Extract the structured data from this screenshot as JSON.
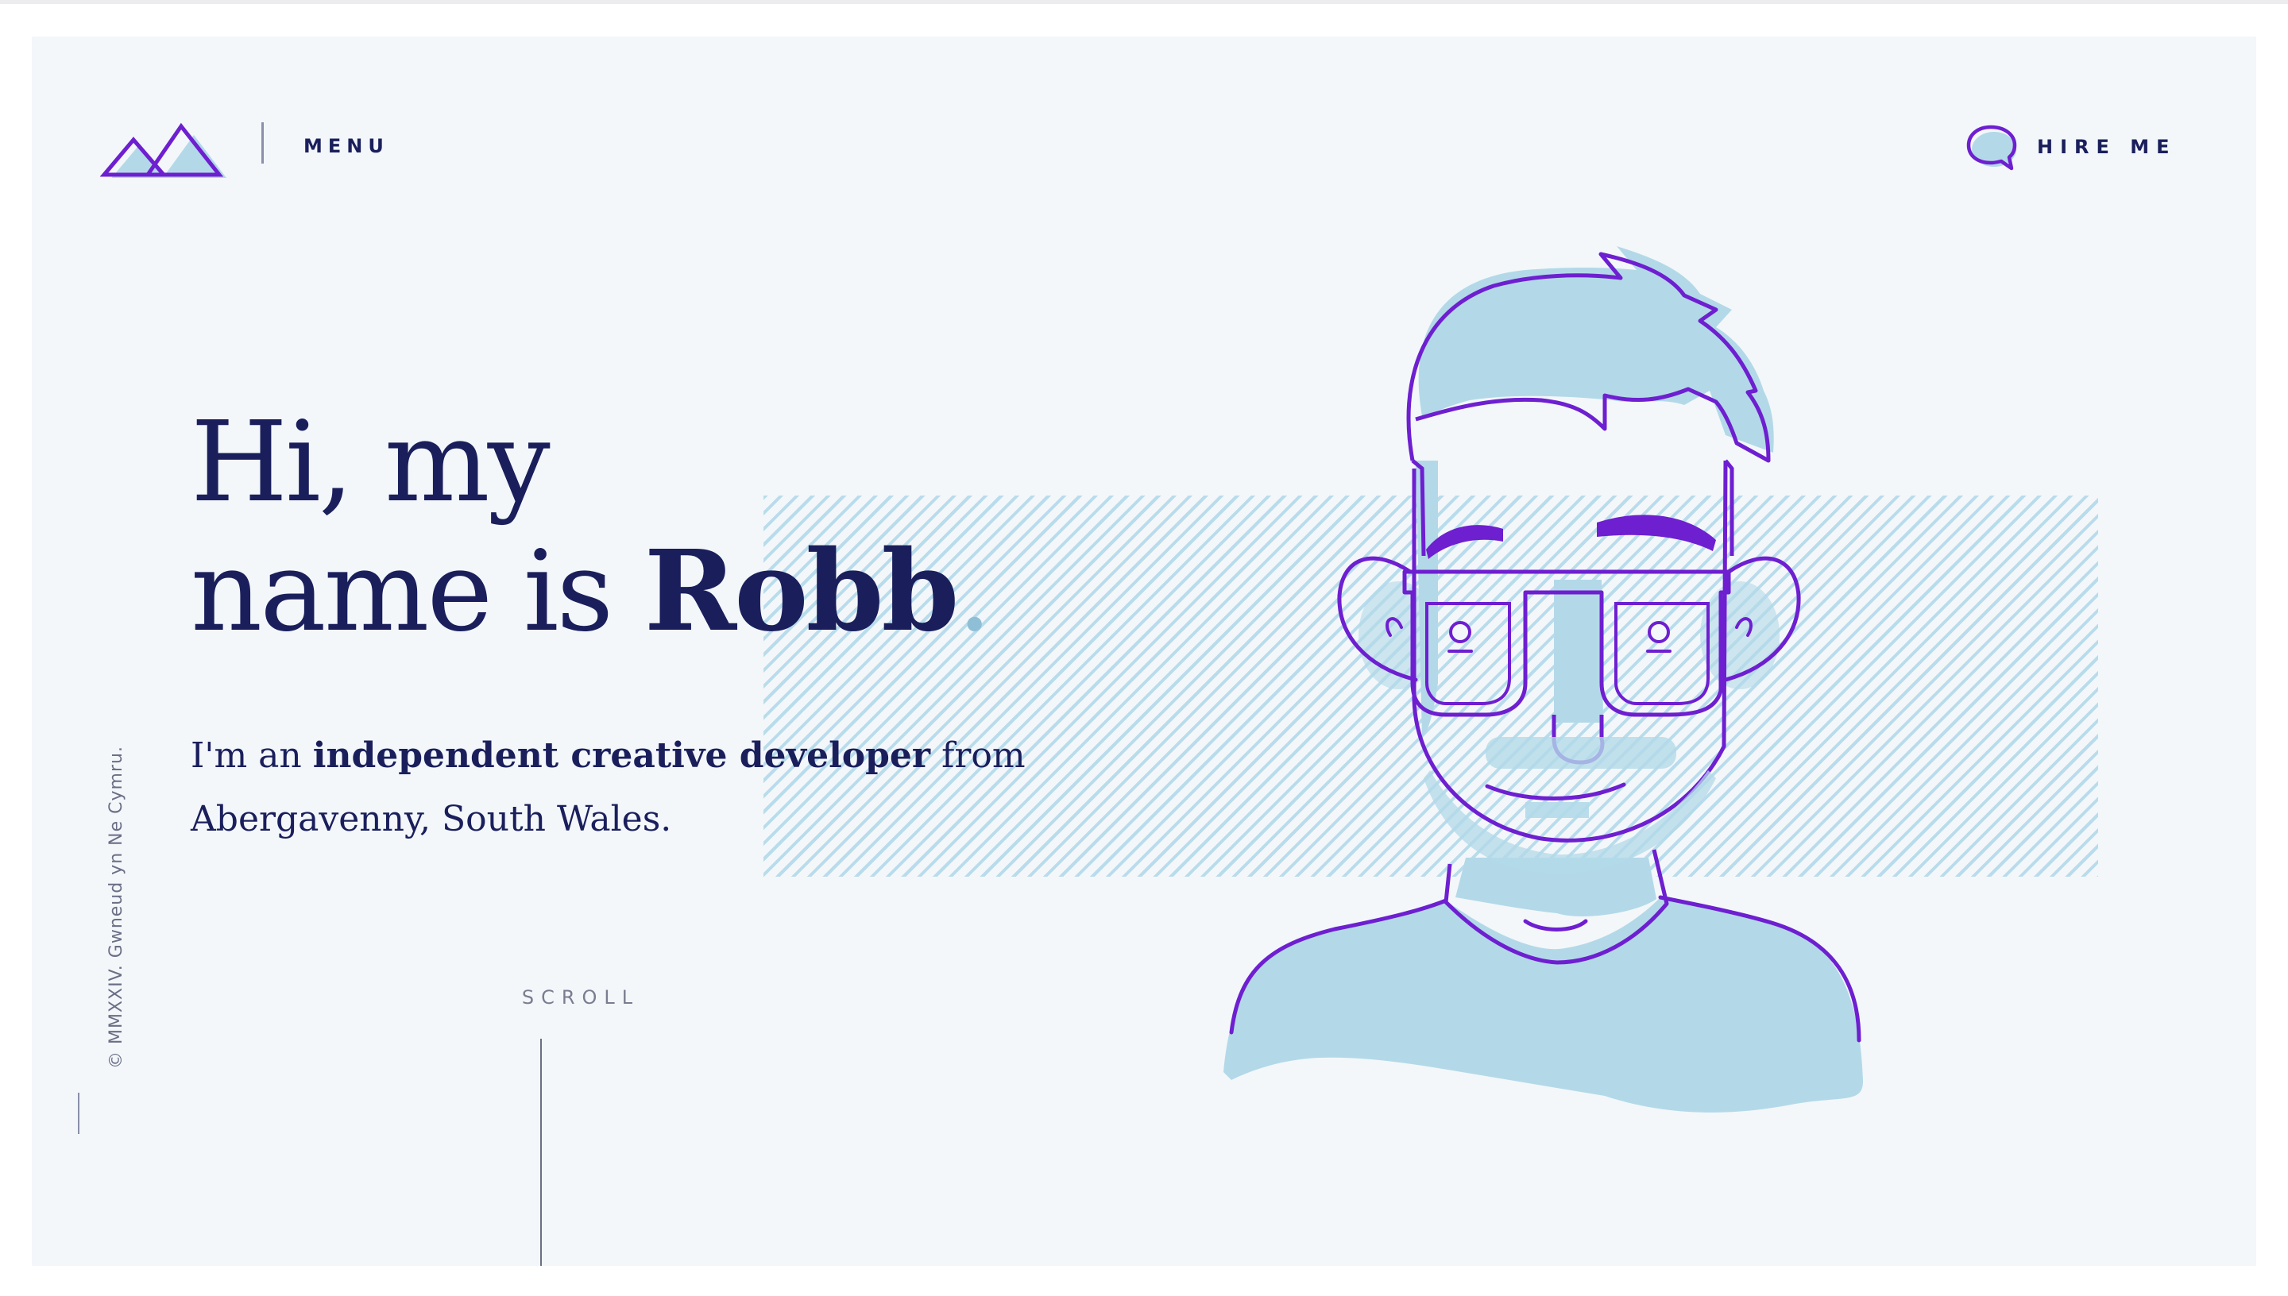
{
  "nav": {
    "menu_label": "MENU",
    "hire_label": "HIRE ME",
    "logo_icon": "mountains-logo-icon",
    "hire_icon": "speech-bubble-icon"
  },
  "hero": {
    "title_line1": "Hi, my",
    "title_line2_prefix": "name is ",
    "title_name": "Robb",
    "title_dot": ".",
    "intro_prefix": "I'm an ",
    "intro_bold": "independent creative developer",
    "intro_suffix": " from",
    "intro_line2": "Abergavenny, South Wales."
  },
  "footer": {
    "copyright": "© MMXXIV. Gwneud yn Ne Cymru.",
    "scroll_label": "SCROLL"
  },
  "colors": {
    "navy": "#1a1f5c",
    "purple": "#6e1fd0",
    "light_blue": "#b3d9e8",
    "background": "#f3f7fa"
  }
}
